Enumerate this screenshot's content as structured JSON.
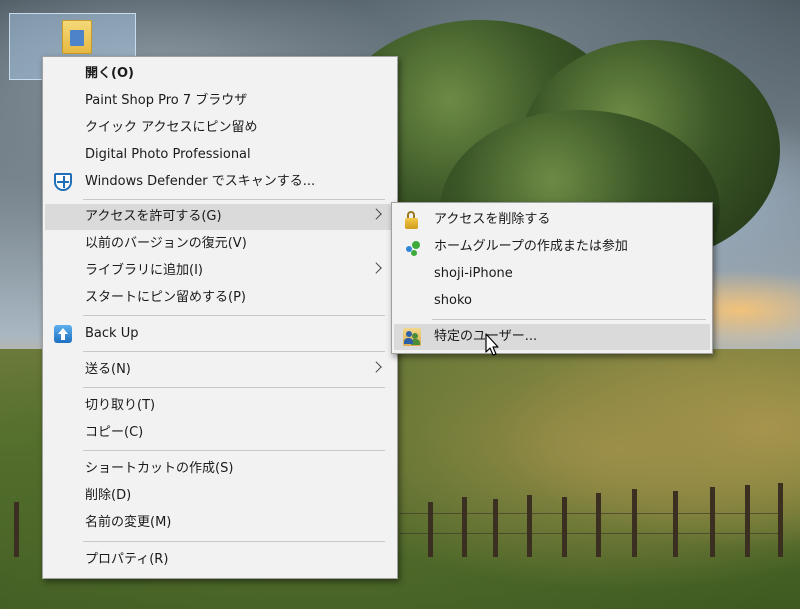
{
  "desktop_icon": {
    "name": "folder",
    "selected": true
  },
  "main_menu": {
    "items": [
      {
        "label": "開く(O)",
        "bold": true
      },
      {
        "label": "Paint Shop Pro 7 ブラウザ"
      },
      {
        "label": "クイック アクセスにピン留め"
      },
      {
        "label": "Digital Photo Professional"
      },
      {
        "label": "Windows Defender でスキャンする...",
        "icon": "shield-icon"
      },
      {
        "label": "アクセスを許可する(G)",
        "submenu": true,
        "highlighted": true
      },
      {
        "label": "以前のバージョンの復元(V)"
      },
      {
        "label": "ライブラリに追加(I)",
        "submenu": true
      },
      {
        "label": "スタートにピン留めする(P)"
      },
      {
        "label": "Back Up",
        "icon": "backup-icon"
      },
      {
        "label": "送る(N)",
        "submenu": true
      },
      {
        "label": "切り取り(T)"
      },
      {
        "label": "コピー(C)"
      },
      {
        "label": "ショートカットの作成(S)"
      },
      {
        "label": "削除(D)"
      },
      {
        "label": "名前の変更(M)"
      },
      {
        "label": "プロパティ(R)"
      }
    ]
  },
  "sub_menu": {
    "items": [
      {
        "label": "アクセスを削除する",
        "icon": "lock-icon"
      },
      {
        "label": "ホームグループの作成または参加",
        "icon": "homegroup-icon"
      },
      {
        "label": "shoji-iPhone"
      },
      {
        "label": "shoko"
      },
      {
        "label": "特定のユーザー...",
        "icon": "users-icon",
        "highlighted": true
      }
    ]
  }
}
